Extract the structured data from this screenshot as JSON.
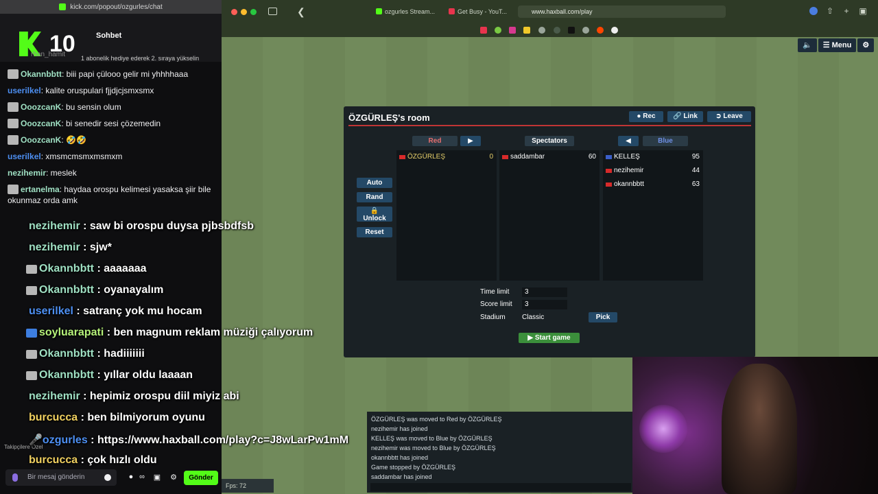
{
  "chat": {
    "url": "kick.com/popout/ozgurles/chat",
    "title": "Sohbet",
    "count": "10",
    "sub_user": "rhan_hamit",
    "sub_info": "1 abonelik hediye ederek 2. sıraya yükselin",
    "messages": [
      {
        "user": "Okannbbtt",
        "text": ": biii papi çülooo gelir mi yhhhhaaa",
        "color": "#9fe0c3"
      },
      {
        "user": "userilkel",
        "text": ": kalite oruspulari fjjdjcjsmxsmx",
        "color": "#4d8ff2"
      },
      {
        "user": "OoozcanK",
        "text": ": bu sensin olum",
        "color": "#9fe0c3"
      },
      {
        "user": "OoozcanK",
        "text": ": bi senedir sesi çözemedin",
        "color": "#9fe0c3"
      },
      {
        "user": "OoozcanK",
        "text": ": 🤣🤣",
        "color": "#9fe0c3"
      },
      {
        "user": "userilkel",
        "text": ": xmsmcmsmxmsmxm",
        "color": "#4d8ff2"
      },
      {
        "user": "nezihemir",
        "text": ": meslek",
        "color": "#9fe0c3"
      },
      {
        "user": "ertanelma",
        "text": ": haydaa orospu kelimesi yasaksa şiir bile okunmaz orda amk",
        "color": "#9fe0c3"
      }
    ],
    "followers_only": "Takipçilere Özel",
    "input_placeholder": "Bir mesaj gönderin",
    "send_label": "Gönder"
  },
  "overlay": [
    {
      "user": "nezihemir",
      "text": " : saw bi orospu duysa pjbsbdfsb",
      "color": "#9fe0c3"
    },
    {
      "user": "nezihemir",
      "text": " : sjw*",
      "color": "#9fe0c3"
    },
    {
      "user": "Okannbbtt",
      "text": " : aaaaaaa",
      "color": "#9fe0c3"
    },
    {
      "user": "Okannbbtt",
      "text": " : oyanayalım",
      "color": "#9fe0c3"
    },
    {
      "user": "userilkel",
      "text": " : satranç yok mu hocam",
      "color": "#4d8ff2"
    },
    {
      "user": "soyluarapati",
      "text": " : ben magnum reklam müziği çalıyorum",
      "color": "#b6f27a"
    },
    {
      "user": "Okannbbtt",
      "text": " : hadiiiiiii",
      "color": "#9fe0c3"
    },
    {
      "user": "Okannbbtt",
      "text": " : yıllar oldu laaaan",
      "color": "#9fe0c3"
    },
    {
      "user": "nezihemir",
      "text": " : hepimiz orospu diil miyiz abi",
      "color": "#9fe0c3"
    },
    {
      "user": "burcucca",
      "text": " : ben bilmiyorum oyunu",
      "color": "#f0d060"
    },
    {
      "user": "ozgurles",
      "text": " : https://www.haxball.com/play?c=J8wLarPw1mM",
      "color": "#4d8ff2"
    },
    {
      "user": "burcucca",
      "text": " : çok hızlı oldu",
      "color": "#f0d060"
    }
  ],
  "browser": {
    "tabs": [
      "ozgurles Stream...",
      "Get Busy - YouT..."
    ],
    "url": "www.haxball.com/play"
  },
  "haxball": {
    "menu_label": "Menu",
    "room_title": "ÖZGÜRLEŞ's room",
    "rec_label": "Rec",
    "link_label": "Link",
    "leave_label": "Leave",
    "red_label": "Red",
    "spectators_label": "Spectators",
    "blue_label": "Blue",
    "red_players": [
      {
        "name": "ÖZGÜRLEŞ",
        "pts": "0"
      }
    ],
    "spectators": [
      {
        "name": "saddambar",
        "pts": "60"
      }
    ],
    "blue_players": [
      {
        "name": "KELLEŞ",
        "pts": "95"
      },
      {
        "name": "nezihemir",
        "pts": "44"
      },
      {
        "name": "okannbbtt",
        "pts": "63"
      }
    ],
    "auto_label": "Auto",
    "rand_label": "Rand",
    "unlock_label": "Unlock",
    "reset_label": "Reset",
    "time_limit_label": "Time limit",
    "time_limit_value": "3",
    "score_limit_label": "Score limit",
    "score_limit_value": "3",
    "stadium_label": "Stadium",
    "stadium_value": "Classic",
    "pick_label": "Pick",
    "start_label": "Start game",
    "log": [
      "ÖZGÜRLEŞ was moved to Red by ÖZGÜRLEŞ",
      "nezihemir has joined",
      "KELLEŞ was moved to Blue by ÖZGÜRLEŞ",
      "nezihemir was moved to Blue by ÖZGÜRLEŞ",
      "okannbbtt has joined",
      "Game stopped by ÖZGÜRLEŞ",
      "saddambar has joined"
    ],
    "fps": "Fps: 72"
  },
  "colors": {
    "kick_green": "#53fc18",
    "red_team": "#e56e6e",
    "blue_team": "#6e8fe5",
    "button": "#244967"
  }
}
